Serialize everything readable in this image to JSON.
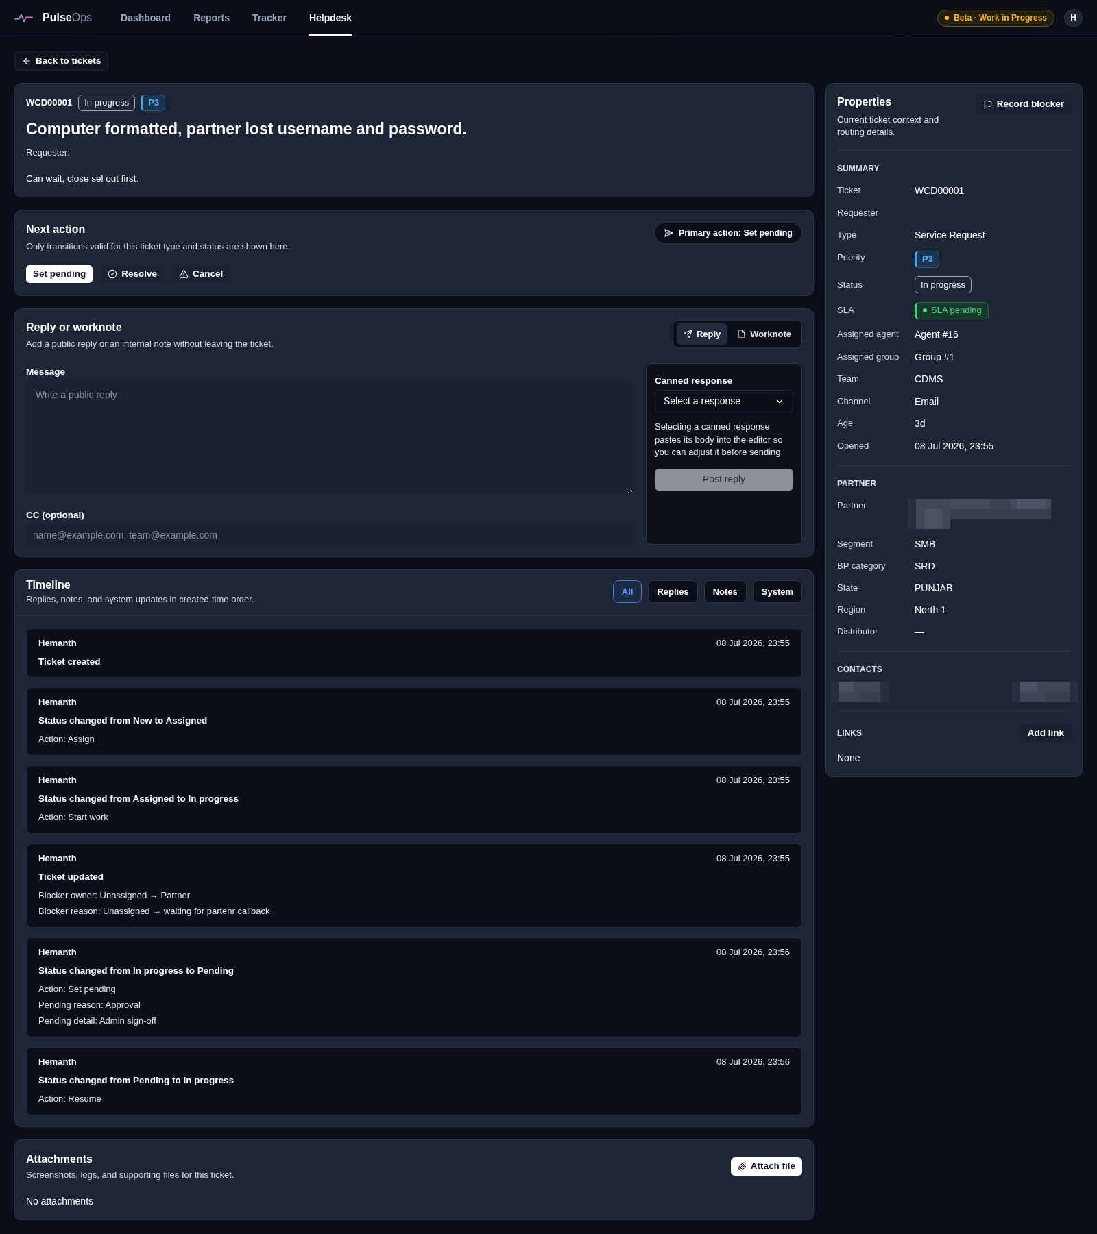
{
  "nav": {
    "brand": "**Pulse**Ops",
    "items": [
      {
        "label": "Dashboard",
        "selected": false
      },
      {
        "label": "Reports",
        "selected": false
      },
      {
        "label": "Tracker",
        "selected": false
      },
      {
        "label": "Helpdesk",
        "selected": true
      }
    ],
    "badge": "Beta - Work in Progress",
    "avatar": "H"
  },
  "back_button": "Back to tickets",
  "ticket": {
    "id": "WCD00001",
    "status": "In progress",
    "priority": "P3",
    "title": "Computer formatted, partner lost username and password.",
    "requester": "Requester:",
    "description": "Can wait, close sel out first."
  },
  "next_action": {
    "title": "Next action",
    "subtitle": "Only transitions valid for this ticket type and status are shown here.",
    "primary_action": "Primary action: Set pending",
    "actions": [
      {
        "label": "Set pending",
        "kind": "primary"
      },
      {
        "label": "Resolve",
        "kind": "plain"
      },
      {
        "label": "Cancel",
        "kind": "plain"
      }
    ]
  },
  "reply": {
    "title": "Reply or worknote",
    "subtitle": "Add a public reply or an internal note without leaving the ticket.",
    "modes": [
      {
        "label": "Reply",
        "selected": true
      },
      {
        "label": "Worknote",
        "selected": false
      }
    ],
    "message": {
      "label": "Message",
      "placeholder": "Write a public reply"
    },
    "cc": {
      "label": "CC (optional)",
      "placeholder": "name@example.com, team@example.com"
    },
    "canned": {
      "label": "Canned response",
      "value": "Select a response",
      "help": "Selecting a canned response pastes its body into the editor so you can adjust it before sending.",
      "post_button": {
        "label": "Post reply",
        "disabled": true
      }
    }
  },
  "timeline": {
    "title": "Timeline",
    "subtitle": "Replies, notes, and system updates in created-time order.",
    "filters": [
      {
        "label": "All",
        "selected": true
      },
      {
        "label": "Replies",
        "selected": false
      },
      {
        "label": "Notes",
        "selected": false
      },
      {
        "label": "System",
        "selected": false
      }
    ],
    "entries": [
      {
        "author": "Hemanth",
        "time": "08 Jul 2026, 23:55",
        "title": "Ticket created"
      },
      {
        "author": "Hemanth",
        "time": "08 Jul 2026, 23:55",
        "title": "Status changed from New to Assigned",
        "details": [
          "Action: Assign"
        ]
      },
      {
        "author": "Hemanth",
        "time": "08 Jul 2026, 23:55",
        "title": "Status changed from Assigned to In progress",
        "details": [
          "Action: Start work"
        ]
      },
      {
        "author": "Hemanth",
        "time": "08 Jul 2026, 23:55",
        "title": "Ticket updated",
        "details": [
          "Blocker owner: Unassigned → Partner",
          "Blocker reason: Unassigned → waiting for partenr callback"
        ]
      },
      {
        "author": "Hemanth",
        "time": "08 Jul 2026, 23:56",
        "title": "Status changed from In progress to Pending",
        "details": [
          "Action: Set pending",
          "Pending reason: Approval",
          "Pending detail: Admin sign-off"
        ]
      },
      {
        "author": "Hemanth",
        "time": "08 Jul 2026, 23:56",
        "title": "Status changed from Pending to In progress",
        "details": [
          "Action: Resume"
        ]
      }
    ]
  },
  "attachments": {
    "title": "Attachments",
    "subtitle": "Screenshots, logs, and supporting files for this ticket.",
    "button": "Attach file",
    "empty": "No attachments"
  },
  "properties": {
    "title": "Properties",
    "subtitle": "Current ticket context and routing details.",
    "button": "Record blocker",
    "summary": {
      "heading": "SUMMARY",
      "rows": [
        {
          "label": "Ticket",
          "kind": "text",
          "value": "WCD00001"
        },
        {
          "label": "Requester",
          "kind": "text"
        },
        {
          "label": "Type",
          "kind": "text",
          "value": "Service Request"
        },
        {
          "label": "Priority",
          "kind": "priority",
          "value": "P3"
        },
        {
          "label": "Status",
          "kind": "status",
          "value": "In progress"
        },
        {
          "label": "SLA",
          "kind": "sla",
          "value": "SLA pending"
        },
        {
          "label": "Assigned agent",
          "kind": "text",
          "value": "Agent #16"
        },
        {
          "label": "Assigned group",
          "kind": "text",
          "value": "Group #1"
        },
        {
          "label": "Team",
          "kind": "text",
          "value": "CDMS"
        },
        {
          "label": "Channel",
          "kind": "text",
          "value": "Email"
        },
        {
          "label": "Age",
          "kind": "text",
          "value": "3d"
        },
        {
          "label": "Opened",
          "kind": "text",
          "value": "08 Jul 2026, 23:55"
        }
      ]
    },
    "partner": {
      "heading": "PARTNER",
      "rows": [
        {
          "label": "Partner",
          "kind": "redacted"
        },
        {
          "label": "Segment",
          "kind": "text",
          "value": "SMB"
        },
        {
          "label": "BP category",
          "kind": "text",
          "value": "SRD"
        },
        {
          "label": "State",
          "kind": "text",
          "value": "PUNJAB"
        },
        {
          "label": "Region",
          "kind": "text",
          "value": "North 1"
        },
        {
          "label": "Distributor",
          "kind": "text",
          "value": "—"
        }
      ]
    },
    "contacts": {
      "heading": "CONTACTS"
    },
    "links": {
      "heading": "LINKS",
      "button": "Add link",
      "empty": "None"
    }
  }
}
